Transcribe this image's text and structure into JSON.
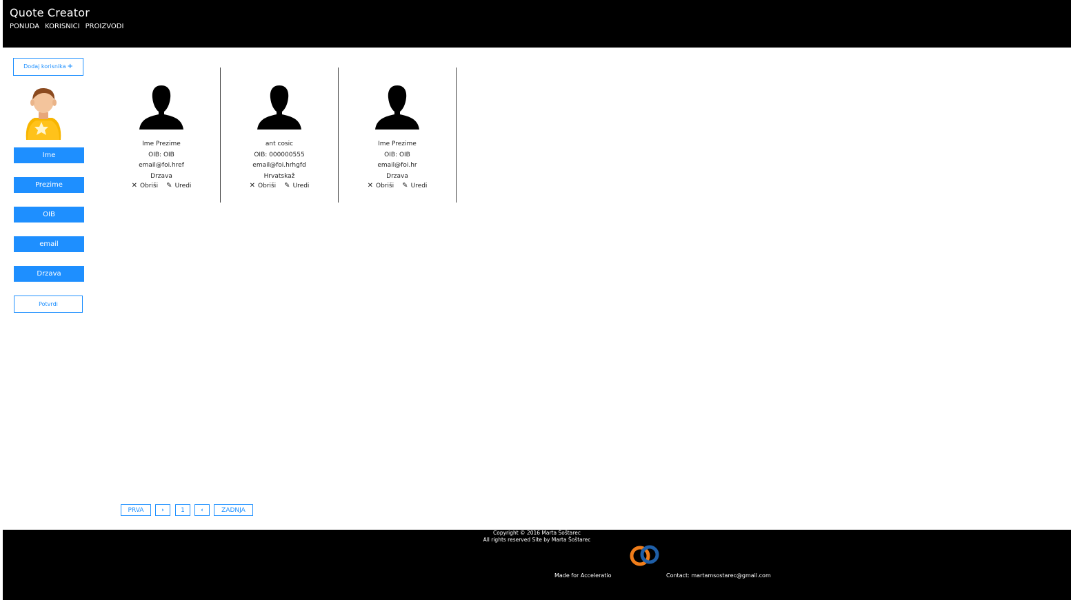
{
  "header": {
    "title": "Quote Creator",
    "nav": [
      "PONUDA",
      "KORISNICI",
      "PROIZVODI"
    ]
  },
  "sidebar": {
    "add_user_label": "Dodaj korisnika",
    "fields": [
      "Ime",
      "Prezime",
      "OIB",
      "email",
      "Drzava"
    ],
    "confirm_label": "Potvrdi"
  },
  "users": [
    {
      "name": "Ime Prezime",
      "oib": "OIB: OIB",
      "email": "email@foi.href",
      "country": "Drzava",
      "delete": "Obriši",
      "edit": "Uredi"
    },
    {
      "name": "ant cosic",
      "oib": "OIB: 000000555",
      "email": "email@foi.hrhgfd",
      "country": "Hrvatskaž",
      "delete": "Obriši",
      "edit": "Uredi"
    },
    {
      "name": "Ime Prezime",
      "oib": "OIB: OIB",
      "email": "email@foi.hr",
      "country": "Drzava",
      "delete": "Obriši",
      "edit": "Uredi"
    }
  ],
  "pagination": {
    "first": "PRVA",
    "next": "›",
    "page": "1",
    "prev": "‹",
    "last": "ZADNJA"
  },
  "footer": {
    "copyright": "Copyright © 2016 Marta Šoštarec",
    "rights": "All rights reserved Site by Marta Šoštarec",
    "made_for": "Made for Acceleratio",
    "contact": "Contact: martamsostarec@gmail.com"
  },
  "colors": {
    "accent": "#1e8fff",
    "header_bg": "#000000"
  }
}
